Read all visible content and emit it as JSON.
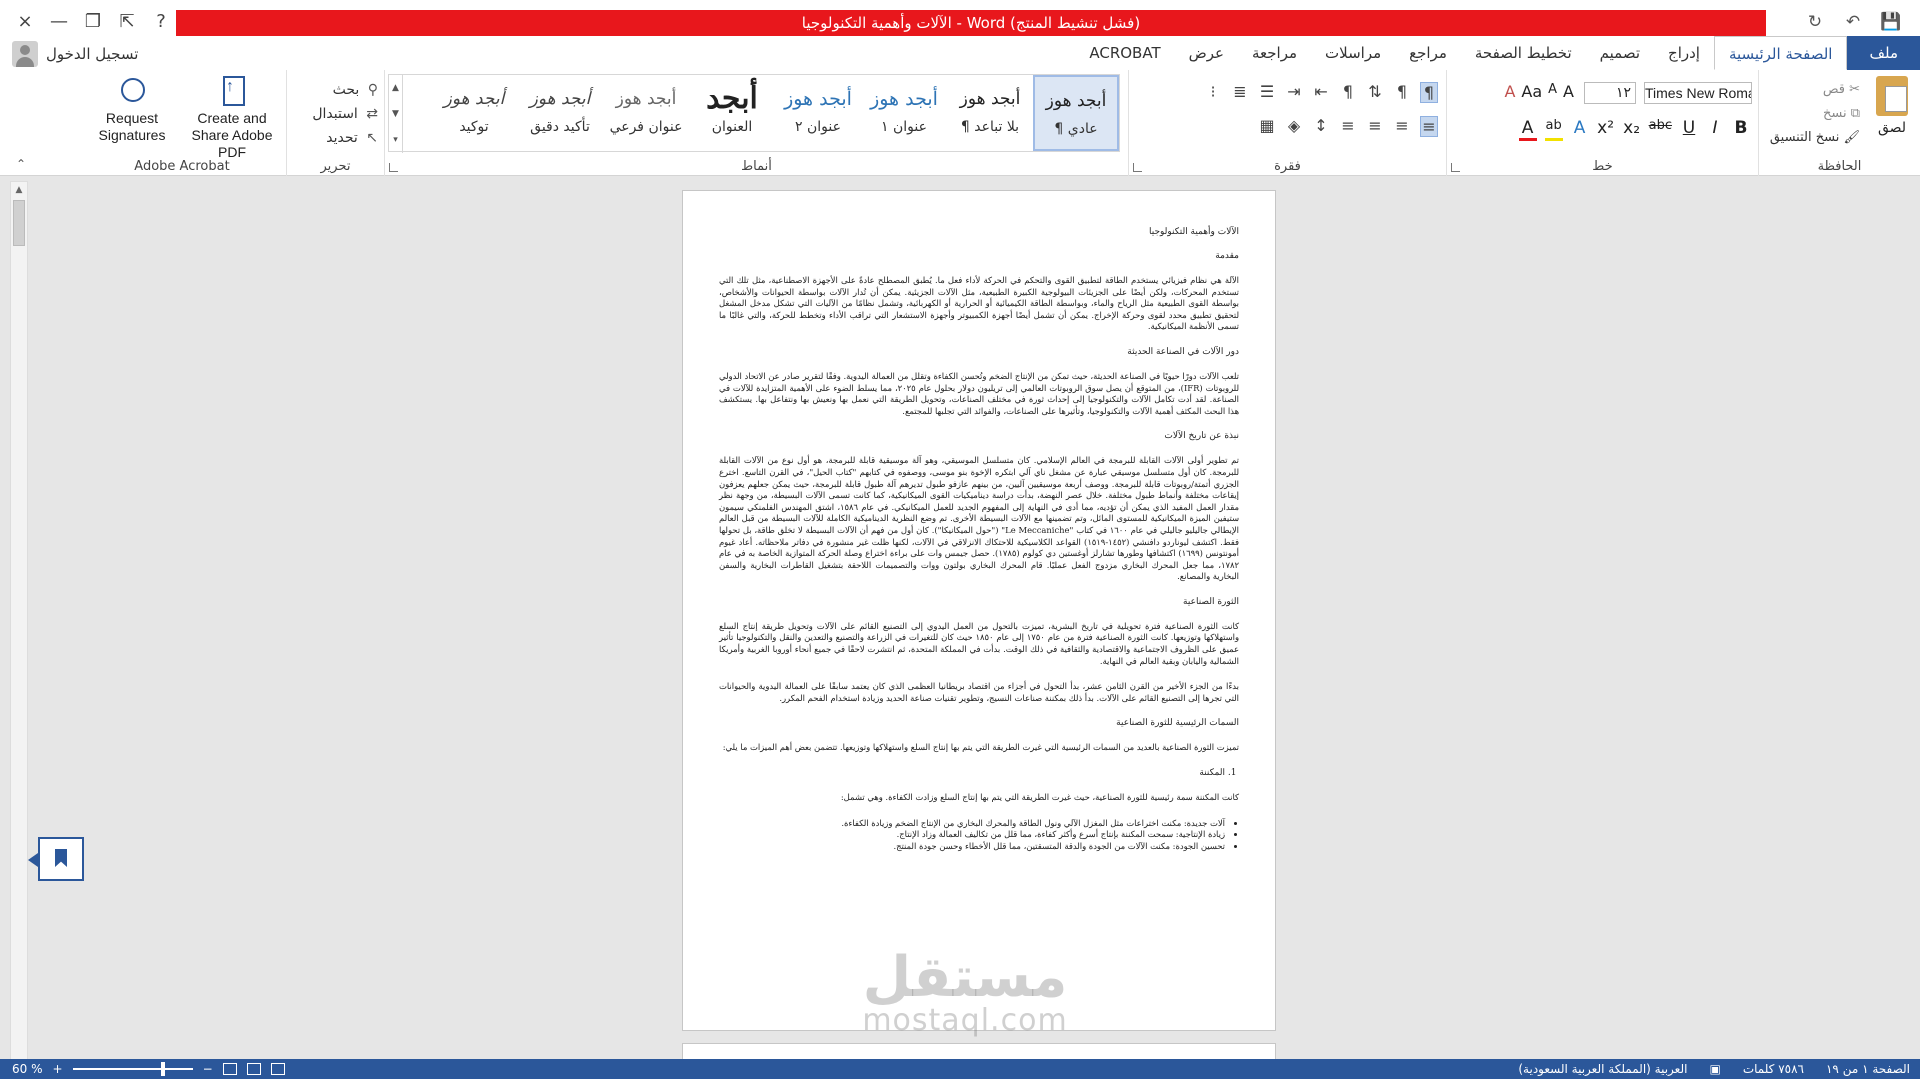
{
  "window": {
    "title": "الآلات وأهمية التكنولوجيا  -  Word  (فشل تنشيط المنتج)",
    "controls": [
      "×",
      "—",
      "❐",
      "⇱",
      "?"
    ],
    "qat": [
      "💾",
      "↶",
      "↻"
    ]
  },
  "account": {
    "signin": "تسجيل الدخول"
  },
  "tabs": [
    {
      "label": "ملف",
      "kind": "file"
    },
    {
      "label": "الصفحة الرئيسية",
      "kind": "active"
    },
    {
      "label": "إدراج"
    },
    {
      "label": "تصميم"
    },
    {
      "label": "تخطيط الصفحة"
    },
    {
      "label": "مراجع"
    },
    {
      "label": "مراسلات"
    },
    {
      "label": "مراجعة"
    },
    {
      "label": "عرض"
    },
    {
      "label": "ACROBAT"
    }
  ],
  "ribbon": {
    "clipboard": {
      "label": "الحافظة",
      "paste": "لصق",
      "cut": "قص",
      "copy": "نسخ",
      "format_painter": "نسخ التنسيق"
    },
    "font": {
      "label": "خط",
      "name": "Times New Roman",
      "size": "١٢",
      "grow": "A",
      "shrink": "A",
      "case": "Aa",
      "clear": "A",
      "bold": "B",
      "italic": "I",
      "underline": "U",
      "strike": "abc",
      "subscript": "x₂",
      "superscript": "x²",
      "effects": "A",
      "highlight": "ab",
      "color": "A"
    },
    "paragraph": {
      "label": "فقرة"
    },
    "styles": {
      "label": "أنماط",
      "items": [
        {
          "sample": "أبجد هوز",
          "name": "¶ عادي",
          "cls": "",
          "selected": true
        },
        {
          "sample": "أبجد هوز",
          "name": "¶ بلا تباعد",
          "cls": ""
        },
        {
          "sample": "أبجد هوز",
          "name": "عنوان ١",
          "cls": "blue"
        },
        {
          "sample": "أبجد هوز",
          "name": "عنوان ٢",
          "cls": "blue"
        },
        {
          "sample": "أبجد",
          "name": "العنوان",
          "cls": "title"
        },
        {
          "sample": "أبجد هوز",
          "name": "عنوان فرعي",
          "cls": "sub"
        },
        {
          "sample": "أبجد هوز",
          "name": "تأكيد دقيق",
          "cls": "em"
        },
        {
          "sample": "أبجد هوز",
          "name": "توكيد",
          "cls": "em"
        }
      ]
    },
    "editing": {
      "label": "تحرير",
      "find": "بحث",
      "replace": "استبدال",
      "select": "تحديد"
    },
    "acrobat": {
      "label": "Adobe Acrobat",
      "create": "Create and Share Adobe PDF",
      "request": "Request Signatures"
    }
  },
  "document": {
    "title": "الآلات وأهمية التكنولوجيا",
    "intro_heading": "مقدمة",
    "intro": "الآلة هي نظام فيزيائي يستخدم الطاقة لتطبيق القوى والتحكم في الحركة لأداء فعل ما. يُطبق المصطلح عادةً على الأجهزة الاصطناعية، مثل تلك التي تستخدم المحركات، ولكن أيضًا على الجزيئات البيولوجية الكبيرة الطبيعية، مثل الآلات الجزيئية. يمكن أن تُدار الآلات بواسطة الحيوانات والأشخاص، بواسطة القوى الطبيعية مثل الرياح والماء، وبواسطة الطاقة الكيميائية أو الحرارية أو الكهربائية، وتشمل نظامًا من الآليات التي تشكل مدخل المشغل لتحقيق تطبيق محدد لقوى وحركة الإخراج. يمكن أن تشمل أيضًا أجهزة الكمبيوتر وأجهزة الاستشعار التي تراقب الأداء وتخطط للحركة، والتي غالبًا ما تسمى الأنظمة الميكانيكية.",
    "role_heading": "دور الآلات في الصناعة الحديثة",
    "role": "تلعب الآلات دورًا حيويًا في الصناعة الحديثة، حيث تمكن من الإنتاج الضخم وتُحسن الكفاءة وتقلل من العمالة اليدوية. وفقًا لتقرير صادر عن الاتحاد الدولي للروبوتات (IFR)، من المتوقع أن يصل سوق الروبوتات العالمي إلى تريليون دولار بحلول عام ٢٠٢٥، مما يسلط الضوء على الأهمية المتزايدة للآلات في الصناعة. لقد أدت تكامل الآلات والتكنولوجيا إلى إحداث ثورة في مختلف الصناعات، وتحويل الطريقة التي نعمل بها ونعيش بها ونتفاعل بها. يستكشف هذا البحث المكثف أهمية الآلات والتكنولوجيا، وتأثيرها على الصناعات، والفوائد التي تجلبها للمجتمع.",
    "history_heading": "نبذة عن تاريخ الآلات",
    "history": "تم تطوير أولى الآلات القابلة للبرمجة في العالم الإسلامي. كان متسلسل الموسيقي، وهو آلة موسيقية قابلة للبرمجة، هو أول نوع من الآلات القابلة للبرمجة. كان أول متسلسل موسيقي عبارة عن مشغل ناي آلي ابتكره الإخوة بنو موسى، ووصفوه في كتابهم \"كتاب الحيل\"، في القرن التاسع. اخترع الجزري أتمتة/روبوتات قابلة للبرمجة. ووصف أربعة موسيقيين آليين، من بينهم عازفو طبول تديرهم آلة طبول قابلة للبرمجة، حيث يمكن جعلهم يعزفون إيقاعات مختلفة وأنماط طبول مختلفة. خلال عصر النهضة، بدأت دراسة ديناميكيات القوى الميكانيكية، كما كانت تسمى الآلات البسيطة، من وجهة نظر مقدار العمل المفيد الذي يمكن أن تؤديه، مما أدى في النهاية إلى المفهوم الجديد للعمل الميكانيكي. في عام ١٥٨٦، اشتق المهندس الفلمنكي سيمون ستيفين الميزة الميكانيكية للمستوى المائل، وتم تضمينها مع الآلات البسيطة الأخرى. تم وضع النظرية الديناميكية الكاملة للآلات البسيطة من قبل العالم الإيطالي جاليليو جاليلي في عام ١٦٠٠ في كتاب \"Le Meccaniche\" (\"حول الميكانيكا\"). كان أول من فهم أن الآلات البسيطة لا تخلق طاقة، بل تحولها فقط. اكتشف ليوناردو دافنشي (١٤٥٢-١٥١٩) القواعد الكلاسيكية للاحتكاك الانزلاقي في الآلات، لكنها ظلت غير منشورة في دفاتر ملاحظاته. أعاد غيوم أمونتونس (١٦٩٩) اكتشافها وطورها تشارلز أوغستين دي كولوم (١٧٨٥). حصل جيمس وات على براءة اختراع وصلة الحركة المتوازية الخاصة به في عام ١٧٨٢، مما جعل المحرك البخاري مزدوج الفعل عمليًا. قام المحرك البخاري بولتون ووات والتصميمات اللاحقة بتشغيل القاطرات البخارية والسفن البخارية والمصانع.",
    "indrev_heading": "الثورة الصناعية",
    "indrev_1": "كانت الثورة الصناعية فترة تحويلية في تاريخ البشرية، تميزت بالتحول من العمل اليدوي إلى التصنيع القائم على الآلات وتحويل طريقة إنتاج السلع واستهلاكها وتوزيعها. كانت الثورة الصناعية فترة من عام ١٧٥٠ إلى عام ١٨٥٠ حيث كان للتغيرات في الزراعة والتصنيع والتعدين والنقل والتكنولوجيا تأثير عميق على الظروف الاجتماعية والاقتصادية والثقافية في ذلك الوقت. بدأت في المملكة المتحدة، ثم انتشرت لاحقًا في جميع أنحاء أوروبا الغربية وأمريكا الشمالية واليابان وبقية العالم في النهاية.",
    "indrev_2": "بدءًا من الجزء الأخير من القرن الثامن عشر، بدأ التحول في أجزاء من اقتصاد بريطانيا العظمى الذي كان يعتمد سابقًا على العمالة اليدوية والحيوانات التي تجرها إلى التصنيع القائم على الآلات. بدأ ذلك بمكننة صناعات النسيج، وتطوير تقنيات صناعة الحديد وزيادة استخدام الفحم المكرر.",
    "features_heading": "السمات الرئيسية للثورة الصناعية",
    "features": "تميزت الثورة الصناعية بالعديد من السمات الرئيسية التي غيرت الطريقة التي يتم بها إنتاج السلع واستهلاكها وتوزيعها. تتضمن بعض أهم الميزات ما يلي:",
    "mech_heading": "المكننة",
    "mech": "كانت المكننة سمة رئيسية للثورة الصناعية، حيث غيرت الطريقة التي يتم بها إنتاج السلع وزادت الكفاءة. وهي تشمل:",
    "bullets": [
      "آلات جديدة: مكنت اختراعات مثل المغزل الآلي ونول الطاقة والمحرك البخاري من الإنتاج الضخم وزيادة الكفاءة.",
      "زيادة الإنتاجية: سمحت المكننة بإنتاج أسرع وأكثر كفاءة، مما قلل من تكاليف العمالة وزاد الإنتاج.",
      "تحسين الجودة: مكنت الآلات من الجودة والدقة المتسقتين، مما قلل الأخطاء وحسن جودة المنتج."
    ]
  },
  "watermark": {
    "big": "مستقل",
    "small": "mostaql.com"
  },
  "status": {
    "page": "الصفحة ١ من ١٩",
    "words": "٧٥٨٦ كلمات",
    "language": "العربية (المملكة العربية السعودية)",
    "zoom": "60 %"
  }
}
